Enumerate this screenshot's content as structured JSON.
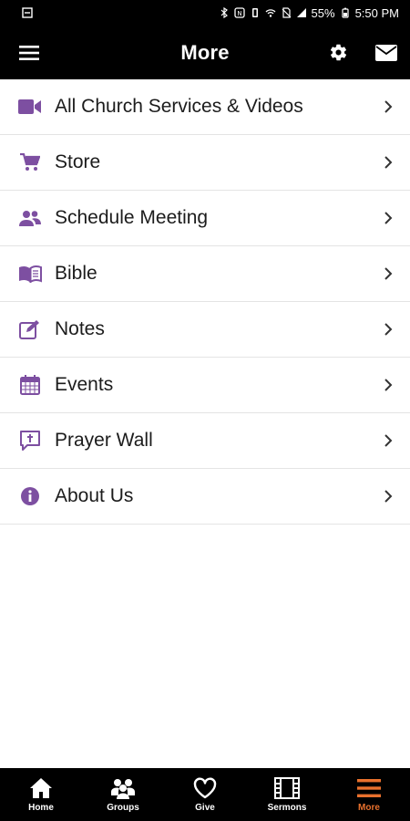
{
  "status_bar": {
    "battery": "55%",
    "time": "5:50 PM"
  },
  "header": {
    "title": "More"
  },
  "menu": [
    {
      "label": "All Church Services & Videos",
      "icon": "video-camera-icon"
    },
    {
      "label": "Store",
      "icon": "shopping-cart-icon"
    },
    {
      "label": "Schedule Meeting",
      "icon": "people-icon"
    },
    {
      "label": "Bible",
      "icon": "open-book-icon"
    },
    {
      "label": "Notes",
      "icon": "pencil-note-icon"
    },
    {
      "label": "Events",
      "icon": "calendar-icon"
    },
    {
      "label": "Prayer Wall",
      "icon": "prayer-bubble-icon"
    },
    {
      "label": "About Us",
      "icon": "info-icon"
    }
  ],
  "bottom_nav": [
    {
      "label": "Home",
      "icon": "home-icon"
    },
    {
      "label": "Groups",
      "icon": "groups-icon"
    },
    {
      "label": "Give",
      "icon": "heart-icon"
    },
    {
      "label": "Sermons",
      "icon": "film-icon"
    },
    {
      "label": "More",
      "icon": "hamburger-icon",
      "active": true
    }
  ],
  "colors": {
    "accent_purple": "#7d4fa1",
    "active_tab": "#e9712d",
    "header_bg": "#000000"
  }
}
